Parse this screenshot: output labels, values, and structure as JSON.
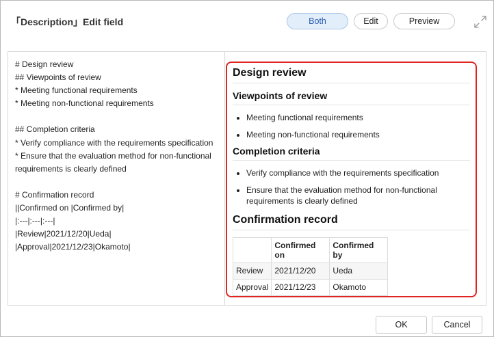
{
  "dialog": {
    "title": "「Description」Edit field",
    "modes": [
      {
        "label": "Both",
        "active": true
      },
      {
        "label": "Edit",
        "active": false
      },
      {
        "label": "Preview",
        "active": false
      }
    ],
    "expand_icon": "expand-arrows-icon"
  },
  "source": {
    "lines": [
      "# Design review",
      "## Viewpoints of review",
      "* Meeting functional requirements",
      "* Meeting non-functional requirements",
      "",
      "## Completion criteria",
      "* Verify compliance with the requirements specification",
      "* Ensure that the evaluation method for non-functional requirements is clearly defined",
      "",
      "# Confirmation record",
      "||Confirmed on |Confirmed by|",
      "|:---|:---|:---|",
      "|Review|2021/12/20|Ueda|",
      "|Approval|2021/12/23|Okamoto|"
    ]
  },
  "preview": {
    "h1_design": "Design review",
    "h2_viewpoints": "Viewpoints of review",
    "viewpoints": [
      "Meeting functional requirements",
      "Meeting non-functional requirements"
    ],
    "h2_completion": "Completion criteria",
    "completion": [
      "Verify compliance with the requirements specification",
      "Ensure that the evaluation method for non-functional requirements is clearly defined"
    ],
    "h1_record": "Confirmation record",
    "table": {
      "headers": [
        "",
        "Confirmed on",
        "Confirmed by"
      ],
      "rows": [
        [
          "Review",
          "2021/12/20",
          "Ueda"
        ],
        [
          "Approval",
          "2021/12/23",
          "Okamoto"
        ]
      ]
    },
    "highlight_color": "#e02424"
  },
  "footer": {
    "ok_label": "OK",
    "cancel_label": "Cancel"
  }
}
